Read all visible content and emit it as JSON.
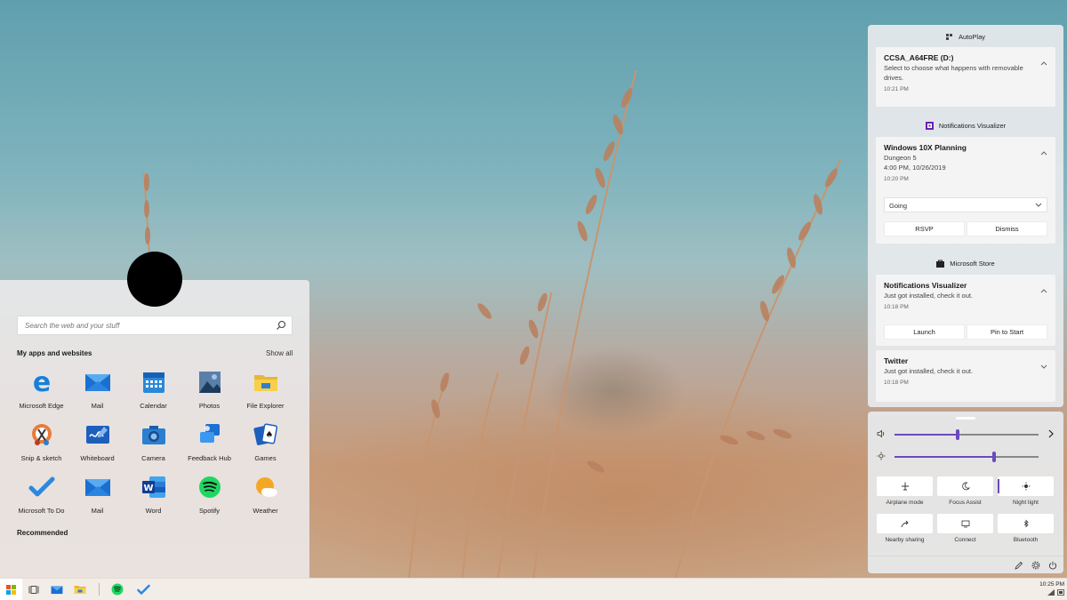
{
  "start_menu": {
    "search_placeholder": "Search the web and your stuff",
    "section_title": "My apps and websites",
    "show_all": "Show all",
    "recommended": "Recommended",
    "apps": [
      {
        "label": "Microsoft Edge",
        "icon": "edge-icon"
      },
      {
        "label": "Mail",
        "icon": "mail-icon"
      },
      {
        "label": "Calendar",
        "icon": "calendar-icon"
      },
      {
        "label": "Photos",
        "icon": "photos-icon"
      },
      {
        "label": "File Explorer",
        "icon": "folder-icon"
      },
      {
        "label": "Snip & sketch",
        "icon": "snip-icon"
      },
      {
        "label": "Whiteboard",
        "icon": "whiteboard-icon"
      },
      {
        "label": "Camera",
        "icon": "camera-icon"
      },
      {
        "label": "Feedback Hub",
        "icon": "feedback-icon"
      },
      {
        "label": "Games",
        "icon": "games-icon"
      },
      {
        "label": "Microsoft To Do",
        "icon": "todo-icon"
      },
      {
        "label": "Mail",
        "icon": "mail-icon"
      },
      {
        "label": "Word",
        "icon": "word-icon"
      },
      {
        "label": "Spotify",
        "icon": "spotify-icon"
      },
      {
        "label": "Weather",
        "icon": "weather-icon"
      }
    ]
  },
  "action_center": {
    "autoplay": {
      "header": "AutoPlay",
      "title": "CCSA_A64FRE (D:)",
      "body": "Select to choose what happens with removable drives.",
      "time": "10:21 PM"
    },
    "visualizer_group": {
      "header": "Notifications Visualizer",
      "title": "Windows 10X Planning",
      "line1": "Dungeon 5",
      "line2": "4:00 PM, 10/26/2019",
      "time": "10:20 PM",
      "select_value": "Going",
      "rsvp": "RSVP",
      "dismiss": "Dismiss"
    },
    "store_group": {
      "header": "Microsoft Store",
      "notif1": {
        "title": "Notifications Visualizer",
        "body": "Just got installed, check it out.",
        "time": "10:18 PM",
        "launch": "Launch",
        "pin": "Pin to Start"
      },
      "notif2": {
        "title": "Twitter",
        "body": "Just got installed, check it out.",
        "time": "10:18 PM"
      }
    }
  },
  "quick_settings": {
    "volume_level": 0.44,
    "brightness_level": 0.69,
    "accent": "#6a4ac0",
    "tiles": [
      {
        "label": "Airplane mode",
        "icon": "airplane-icon",
        "active": false
      },
      {
        "label": "Focus Assist",
        "icon": "moon-icon",
        "active": false
      },
      {
        "label": "Night light",
        "icon": "sun-icon",
        "active": true
      },
      {
        "label": "Nearby sharing",
        "icon": "share-icon",
        "active": false
      },
      {
        "label": "Connect",
        "icon": "cast-icon",
        "active": false
      },
      {
        "label": "Bluetooth",
        "icon": "bluetooth-icon",
        "active": false
      }
    ]
  },
  "taskbar": {
    "time": "10:25 PM"
  }
}
